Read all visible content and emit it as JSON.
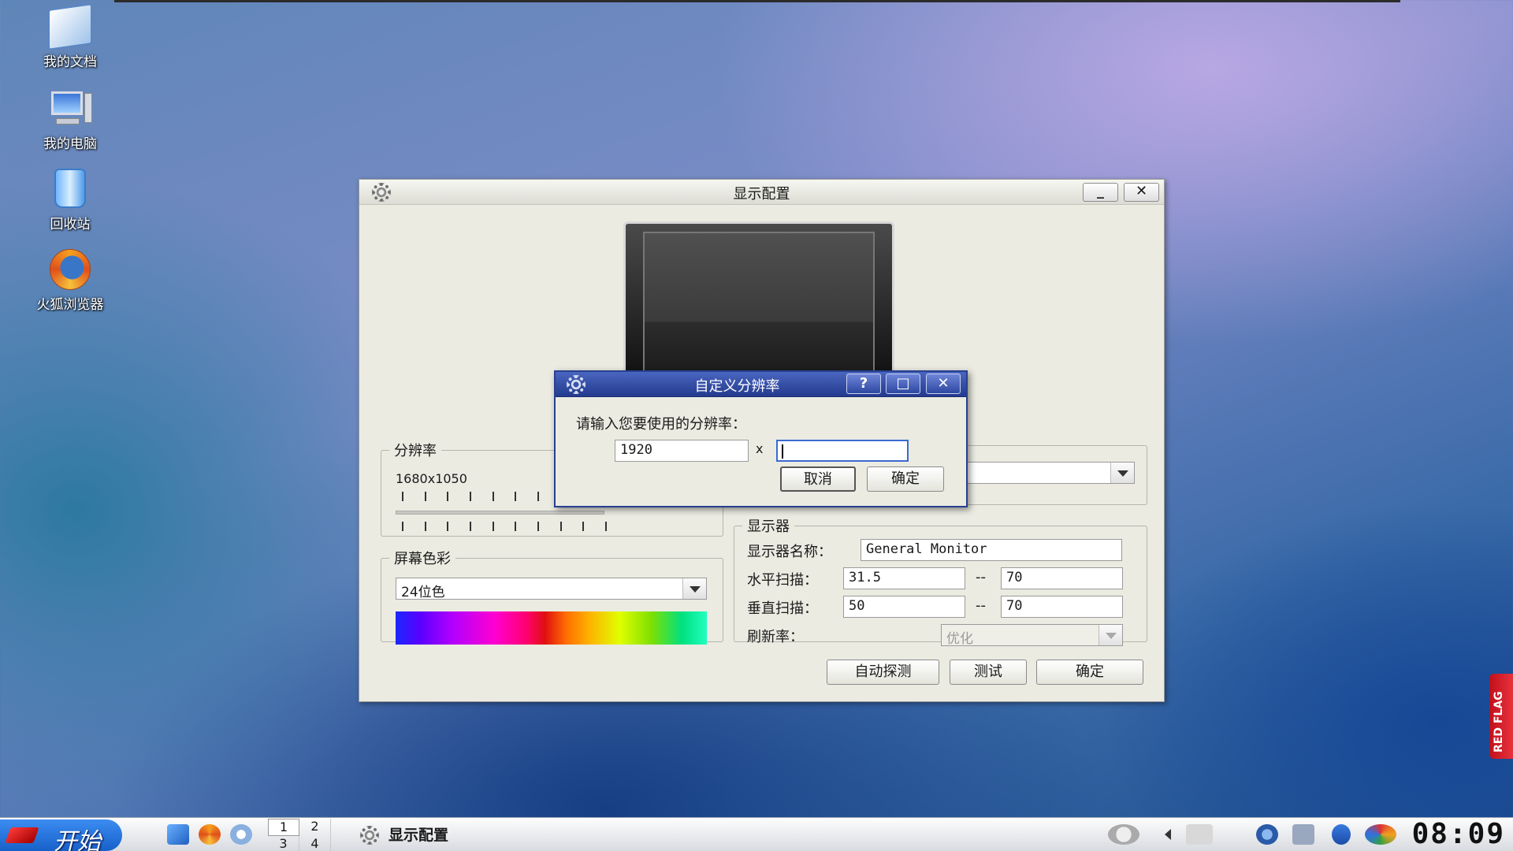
{
  "desktop": {
    "icons": [
      {
        "label": "我的文档",
        "icon": "my-documents-icon"
      },
      {
        "label": "我的电脑",
        "icon": "my-computer-icon"
      },
      {
        "label": "回收站",
        "icon": "recycle-bin-icon"
      },
      {
        "label": "火狐浏览器",
        "icon": "firefox-icon"
      }
    ]
  },
  "main_window": {
    "title": "显示配置",
    "resolution": {
      "legend": "分辨率",
      "current": "1680x1050"
    },
    "color_depth": {
      "legend": "屏幕色彩",
      "selected": "24位色"
    },
    "monitor": {
      "legend": "显示器",
      "name_label": "显示器名称：",
      "name_value": "General Monitor",
      "hsync_label": "水平扫描：",
      "hsync_min": "31.5",
      "hsync_max": "70",
      "vsync_label": "垂直扫描：",
      "vsync_min": "50",
      "vsync_max": "70",
      "refresh_label": "刷新率：",
      "refresh_value": "优化",
      "range_sep": "--"
    },
    "buttons": {
      "auto_detect": "自动探测",
      "test": "测试",
      "ok": "确定"
    }
  },
  "dialog": {
    "title": "自定义分辨率",
    "help_btn": "?",
    "prompt": "请输入您要使用的分辨率：",
    "width_value": "1920",
    "times": "x",
    "height_value": "",
    "cancel": "取消",
    "ok": "确定"
  },
  "taskbar": {
    "start_label": "开始",
    "pager": [
      "1",
      "2",
      "3",
      "4"
    ],
    "task_label": "显示配置",
    "clock": "08:09"
  },
  "badge": {
    "text": "RED FLAG"
  },
  "colors": {
    "dialog_title": "#233a8e",
    "window_bg": "#ebebe2",
    "start_button": "#1761c9"
  }
}
